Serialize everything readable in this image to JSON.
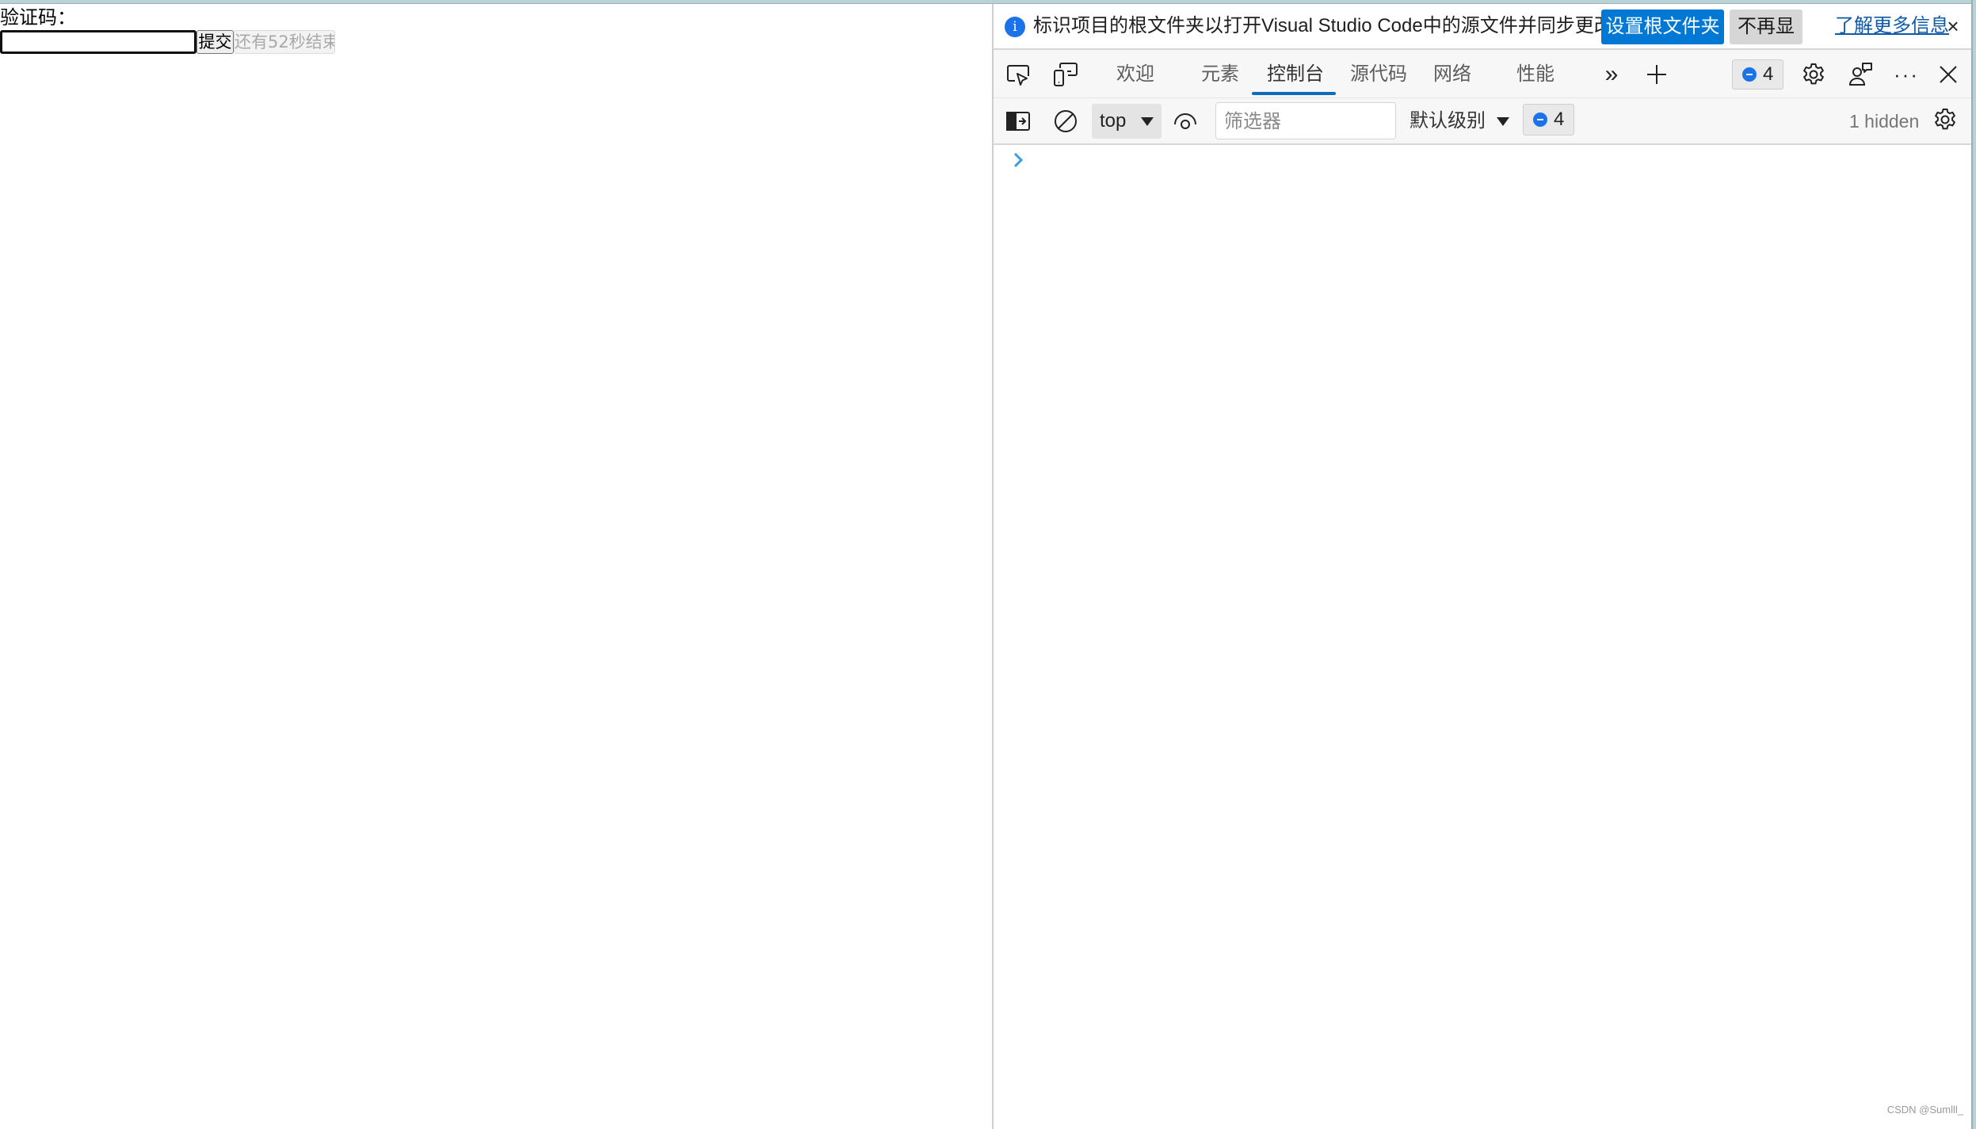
{
  "page": {
    "label": "验证码：",
    "input": {
      "value": "",
      "placeholder": ""
    },
    "submit_label": "提交",
    "timer_label": "还有52秒结束"
  },
  "devtools": {
    "infobar": {
      "icon": "info-icon",
      "message": "标识项目的根文件夹以打开Visual Studio Code中的源文件并同步更改。",
      "primary_button": "设置根文件夹",
      "secondary_button": "不再显示",
      "link": "了解更多信息",
      "close": "×"
    },
    "toolbar": {
      "icons": [
        "inspect-element-icon",
        "device-emulation-icon"
      ],
      "tabs": [
        {
          "label": "欢迎",
          "active": false
        },
        {
          "label": "元素",
          "active": false
        },
        {
          "label": "控制台",
          "active": true
        },
        {
          "label": "源代码",
          "active": false
        },
        {
          "label": "网络",
          "active": false
        },
        {
          "label": "性能",
          "active": false
        }
      ],
      "more_tabs": "»",
      "add_tab": "+",
      "issues_count": "4",
      "accent_color": "#0f6cbd"
    },
    "console_toolbar": {
      "context": "top",
      "filter_placeholder": "筛选器",
      "filter_value": "",
      "level": "默认级别",
      "issues_count": "4",
      "hidden": "1 hidden"
    },
    "console": {
      "prompt": "›"
    }
  },
  "watermark": "CSDN @Sumlll_",
  "colors": {
    "primary_button": "#0078d4",
    "link": "#0f5aa8",
    "info_icon": "#1a73e8",
    "prompt": "#1a8fe3"
  }
}
